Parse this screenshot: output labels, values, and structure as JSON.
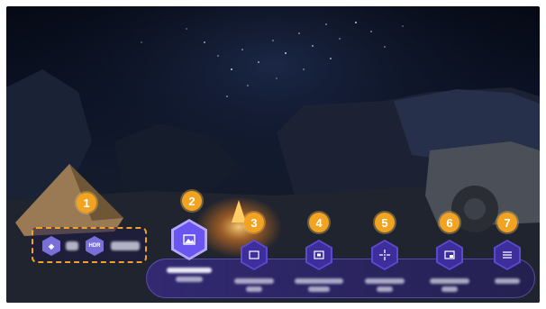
{
  "markers": [
    "1",
    "2",
    "3",
    "4",
    "5",
    "6",
    "7"
  ],
  "status": {
    "badge_hdr": "HDR"
  },
  "options": [
    {
      "icon": "picture-icon",
      "selected": true
    },
    {
      "icon": "aspect-ratio-icon",
      "selected": false
    },
    {
      "icon": "screen-fit-icon",
      "selected": false
    },
    {
      "icon": "crosshair-icon",
      "selected": false
    },
    {
      "icon": "picture-in-picture-icon",
      "selected": false
    },
    {
      "icon": "menu-icon",
      "selected": false
    }
  ],
  "colors": {
    "marker": "#f2a321",
    "accent": "#6a55f0",
    "bar": "#3d2e9c"
  }
}
